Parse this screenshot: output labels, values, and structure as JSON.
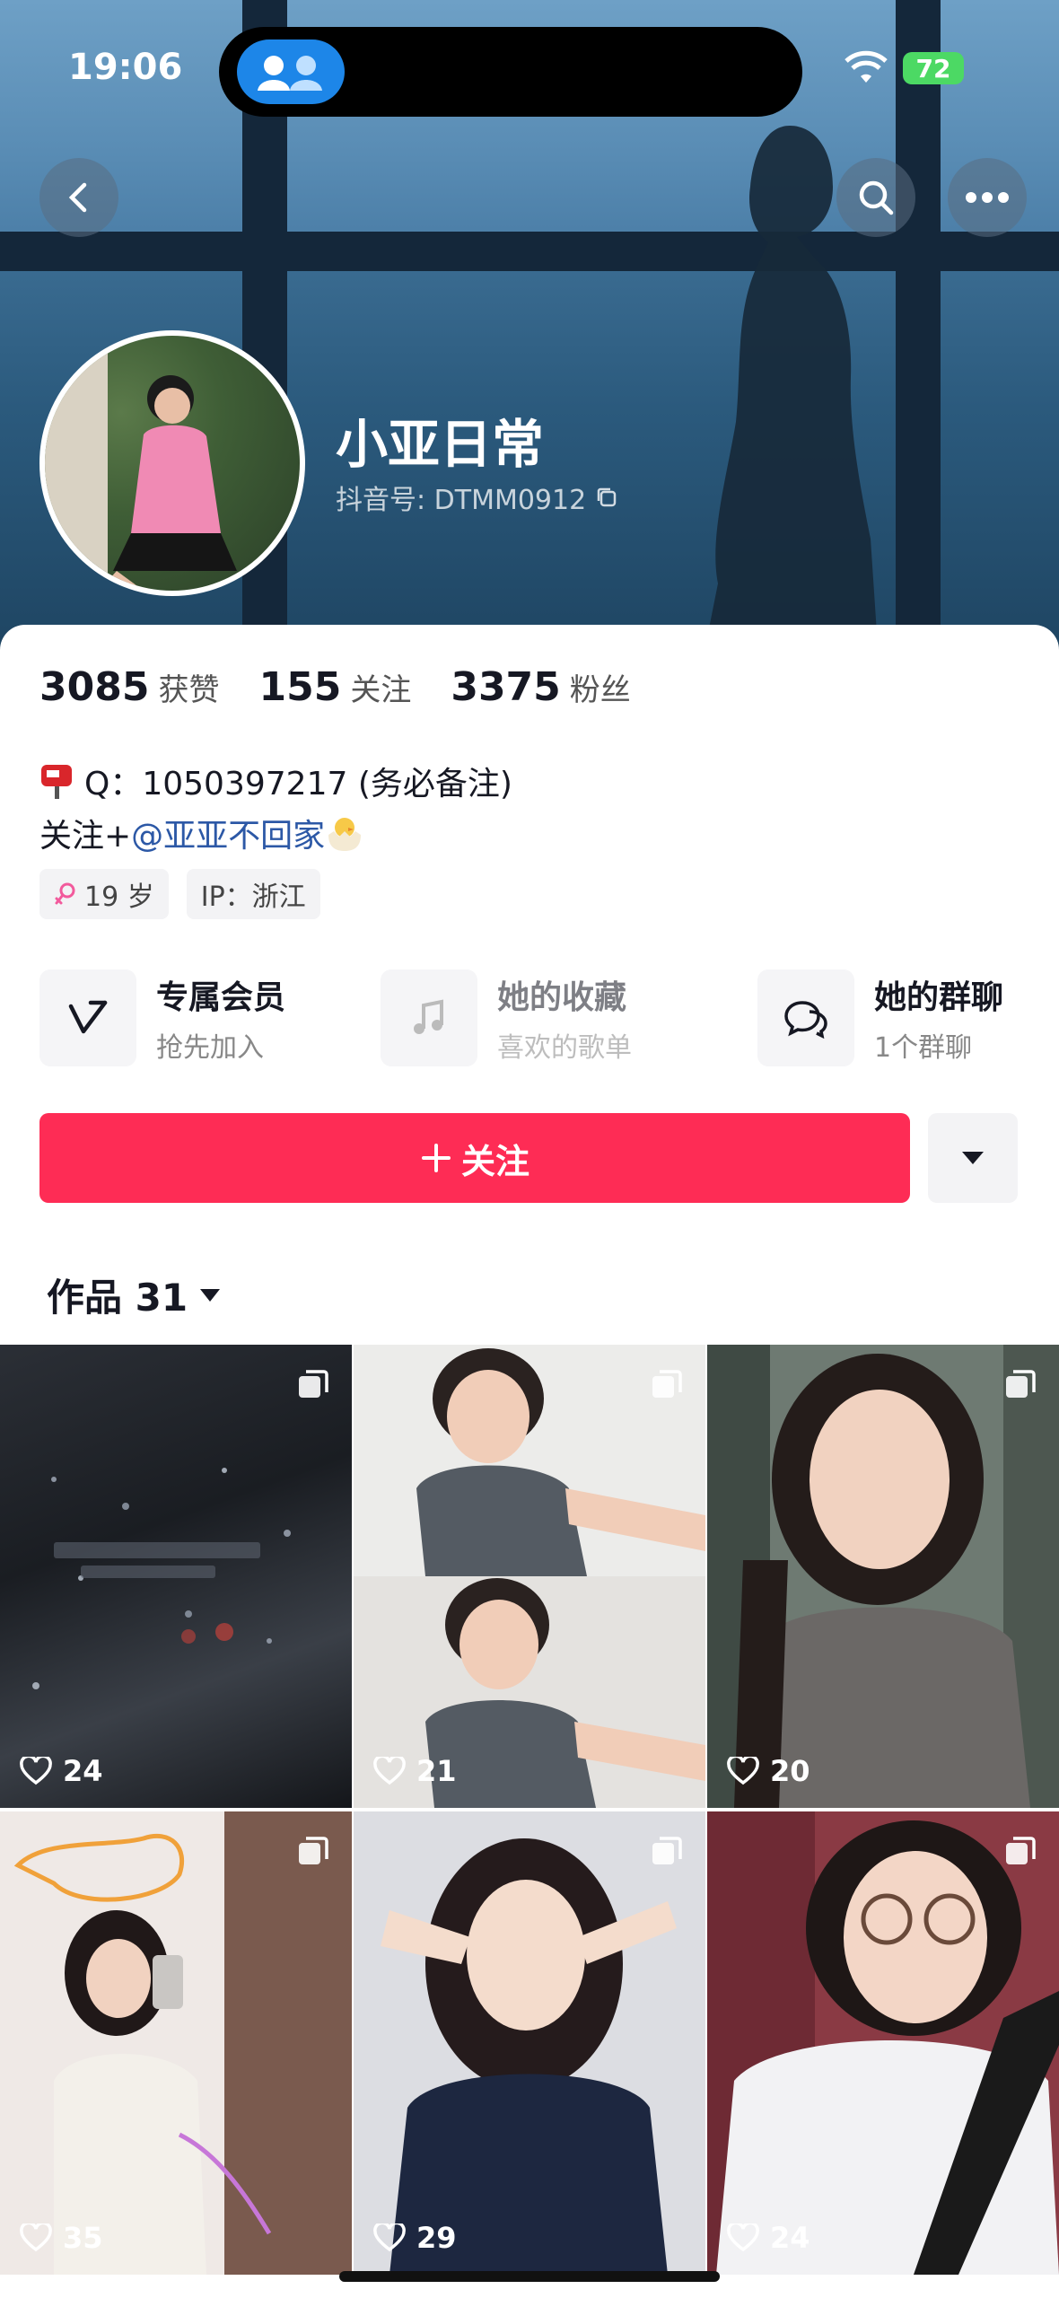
{
  "status_bar": {
    "time": "19:06",
    "battery": "72"
  },
  "profile": {
    "nickname": "小亚日常",
    "douyin_id": "抖音号: DTMM0912",
    "stats": [
      {
        "num": "3085",
        "label": "获赞"
      },
      {
        "num": "155",
        "label": "关注"
      },
      {
        "num": "3375",
        "label": "粉丝"
      }
    ],
    "bio_line1": "Q：1050397217 (务必备注)",
    "bio_line2_prefix": "关注+",
    "bio_line2_mention": "@亚亚不回家",
    "tags": [
      "19 岁",
      "IP：浙江"
    ]
  },
  "services": [
    {
      "title": "专属会员",
      "sub": "抢先加入"
    },
    {
      "title": "她的收藏",
      "sub": "喜欢的歌单"
    },
    {
      "title": "她的群聊",
      "sub": "1个群聊"
    }
  ],
  "follow_label": "关注",
  "works_tab": "作品 31",
  "posts": [
    {
      "likes": "24"
    },
    {
      "likes": "21"
    },
    {
      "likes": "20"
    },
    {
      "likes": "35"
    },
    {
      "likes": "29"
    },
    {
      "likes": "24"
    }
  ],
  "colors": {
    "accent": "#fe2c55",
    "mention": "#2c58a6"
  }
}
